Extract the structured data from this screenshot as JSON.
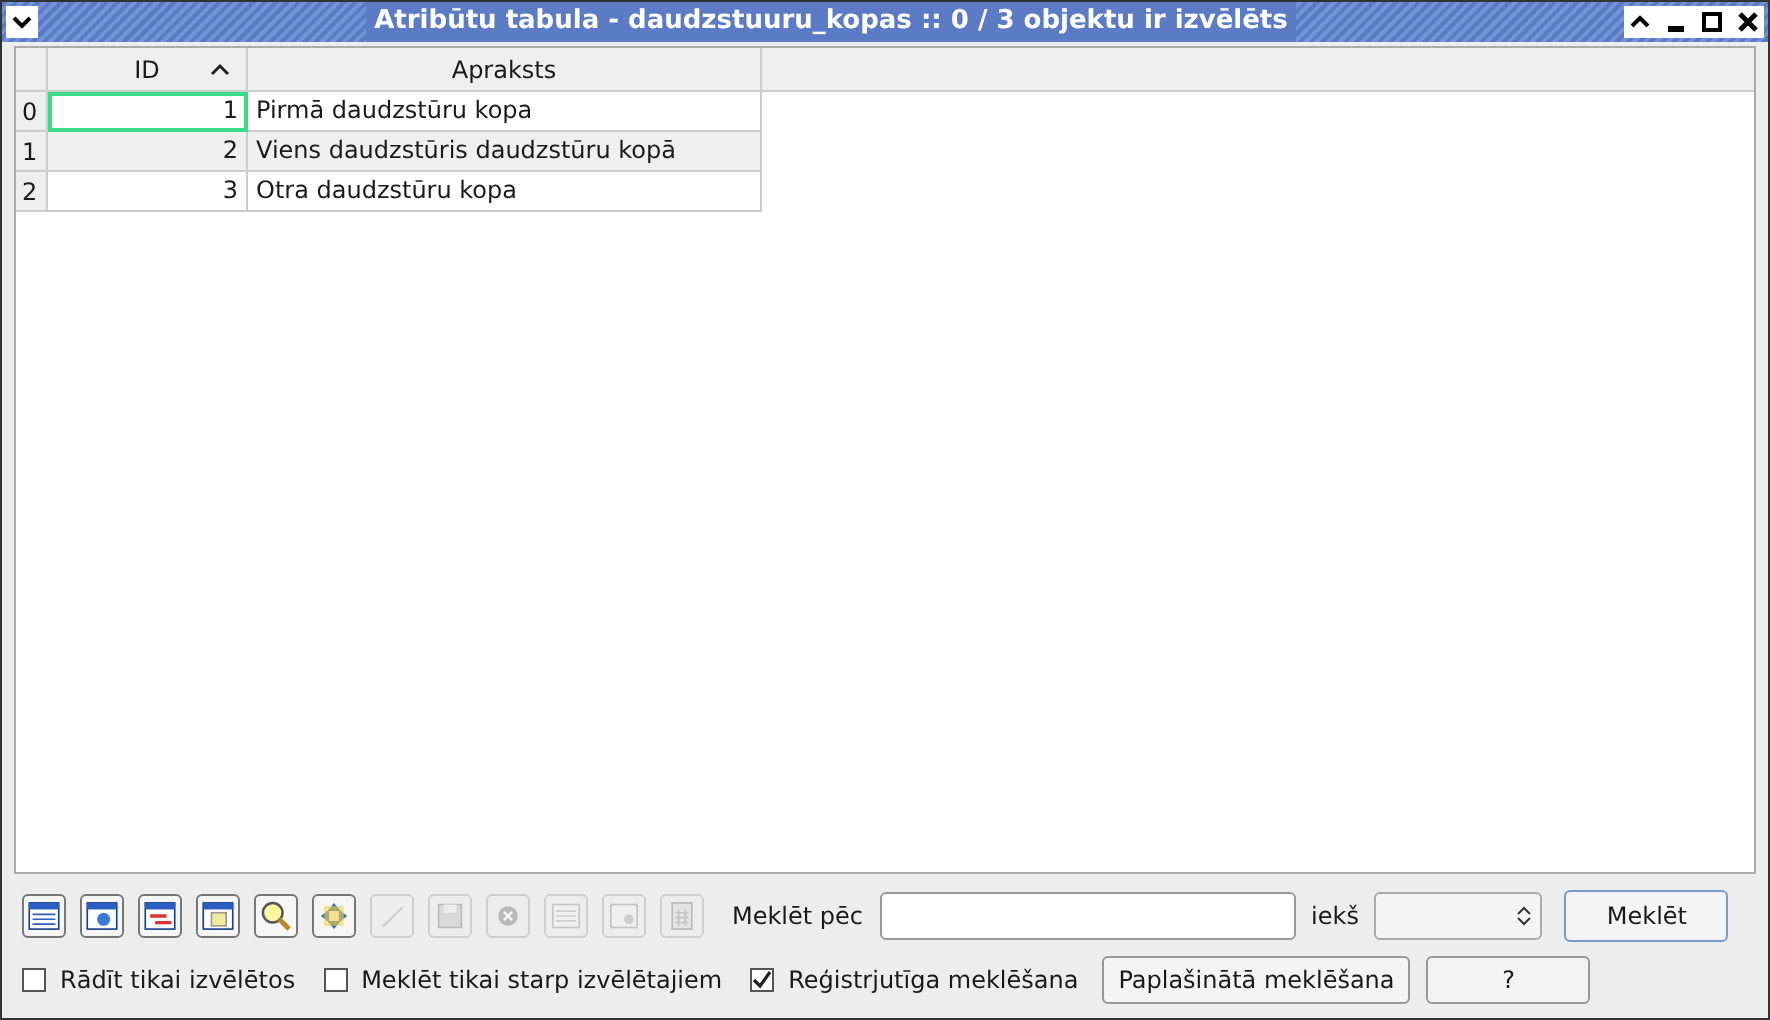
{
  "window": {
    "title": "Atribūtu tabula - daudzstuuru_kopas :: 0 / 3 objektu ir izvēlēts"
  },
  "table": {
    "columns": [
      {
        "label": "ID",
        "sorted": true
      },
      {
        "label": "Apraksts",
        "sorted": false
      }
    ],
    "rows": [
      {
        "header": "0",
        "cells": [
          "1",
          "Pirmā daudzstūru kopa"
        ],
        "focused": true
      },
      {
        "header": "1",
        "cells": [
          "2",
          "Viens daudzstūris daudzstūru kopā"
        ],
        "focused": false
      },
      {
        "header": "2",
        "cells": [
          "3",
          "Otra daudzstūru kopa"
        ],
        "focused": false
      }
    ]
  },
  "toolbar": [
    {
      "kind": "table",
      "disabled": false
    },
    {
      "kind": "zoom",
      "disabled": false
    },
    {
      "kind": "swap",
      "disabled": false
    },
    {
      "kind": "copy",
      "disabled": false
    },
    {
      "kind": "search",
      "disabled": false
    },
    {
      "kind": "pan",
      "disabled": false
    },
    {
      "kind": "pencil",
      "disabled": true
    },
    {
      "kind": "save",
      "disabled": true
    },
    {
      "kind": "delete",
      "disabled": true
    },
    {
      "kind": "addcol",
      "disabled": true
    },
    {
      "kind": "delcol",
      "disabled": true
    },
    {
      "kind": "calc",
      "disabled": true
    }
  ],
  "search": {
    "label": "Meklēt pēc",
    "in_label": "iekš",
    "button": "Meklēt"
  },
  "options": [
    {
      "label": "Rādīt tikai izvēlētos",
      "checked": false
    },
    {
      "label": "Meklēt tikai starp izvēlētajiem",
      "checked": false
    },
    {
      "label": "Reģistrjutīga meklēšana",
      "checked": true
    }
  ],
  "buttons": [
    "Paplašinātā meklēšana",
    "?"
  ]
}
